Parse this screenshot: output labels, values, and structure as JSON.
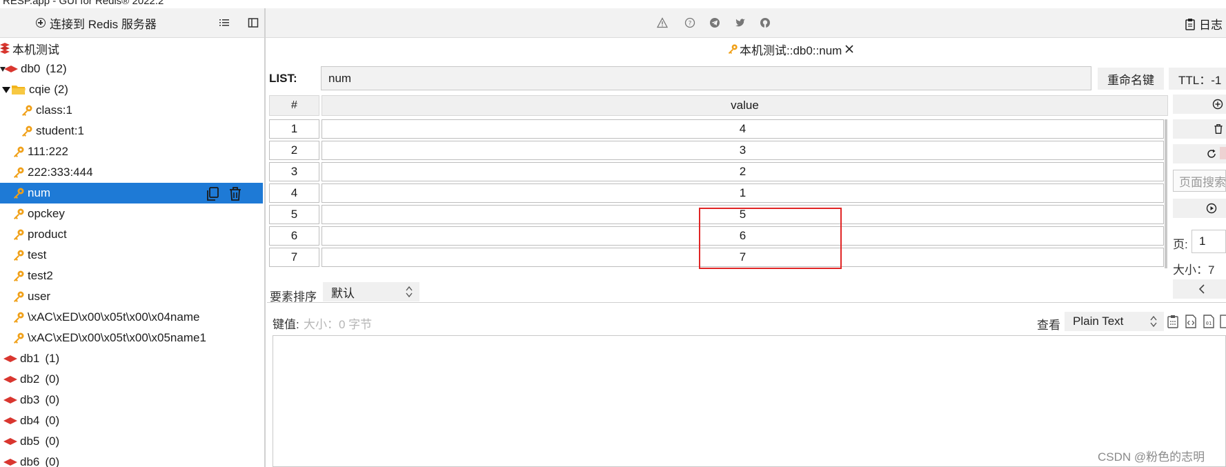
{
  "window": {
    "title": "RESP.app - GUI for Redis® 2022.2"
  },
  "toolbar": {
    "connect_label": "连接到 Redis 服务器",
    "log_label": "日志"
  },
  "tree": {
    "connection": "本机测试",
    "db0": {
      "name": "db0",
      "count": "(12)"
    },
    "folder": {
      "name": "cqie",
      "count": "(2)"
    },
    "folder_keys": [
      "class:1",
      "student:1"
    ],
    "keys": [
      "111:222",
      "222:333:444",
      "num",
      "opckey",
      "product",
      "test",
      "test2",
      "user",
      "\\xAC\\xED\\x00\\x05t\\x00\\x04name",
      "\\xAC\\xED\\x00\\x05t\\x00\\x05name1"
    ],
    "selected_key": "num",
    "other_dbs": [
      {
        "name": "db1",
        "count": "(1)"
      },
      {
        "name": "db2",
        "count": "(0)"
      },
      {
        "name": "db3",
        "count": "(0)"
      },
      {
        "name": "db4",
        "count": "(0)"
      },
      {
        "name": "db5",
        "count": "(0)"
      },
      {
        "name": "db6",
        "count": "(0)"
      }
    ]
  },
  "tab": {
    "label": "本机测试::db0::num"
  },
  "key_info": {
    "type_label": "LIST:",
    "key_name": "num",
    "rename_label": "重命名键",
    "ttl_label": "TTL：-1"
  },
  "table": {
    "headers": [
      "#",
      "value"
    ],
    "rows": [
      {
        "index": "1",
        "value": "4"
      },
      {
        "index": "2",
        "value": "3"
      },
      {
        "index": "3",
        "value": "2"
      },
      {
        "index": "4",
        "value": "1"
      },
      {
        "index": "5",
        "value": "5"
      },
      {
        "index": "6",
        "value": "6"
      },
      {
        "index": "7",
        "value": "7"
      }
    ]
  },
  "side": {
    "search_placeholder": "页面搜索",
    "page_label": "页:",
    "page_value": "1",
    "size_label": "大小：7"
  },
  "sort": {
    "label": "要素排序",
    "value": "默认"
  },
  "value_panel": {
    "label": "键值:",
    "size": "大小：0 字节",
    "view_label": "查看",
    "view_mode": "Plain Text"
  },
  "watermark": "CSDN @粉色的志明",
  "colors": {
    "selection": "#1e7ad6",
    "key_icon": "#f0a018",
    "db_icon": "#d9362f",
    "highlight_box": "#e02525"
  }
}
